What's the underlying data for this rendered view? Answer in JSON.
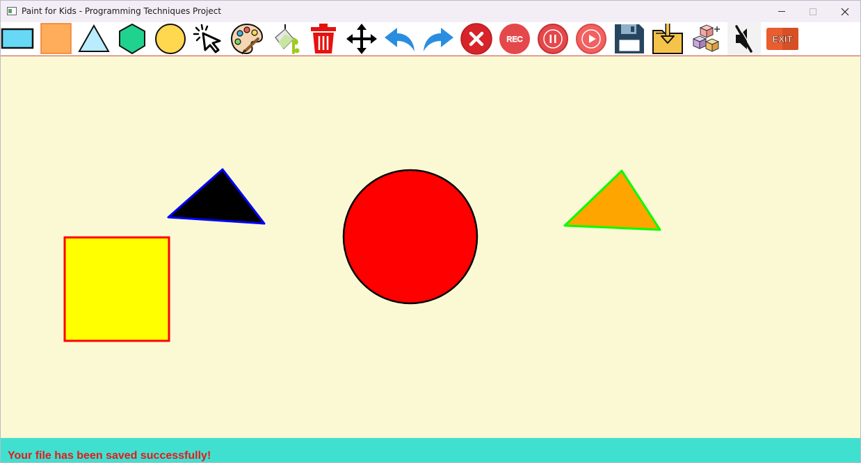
{
  "window": {
    "title": "Paint for Kids - Programming Techniques Project",
    "controls": {
      "minimize": "minimize",
      "maximize": "maximize",
      "close": "close"
    }
  },
  "toolbar": {
    "items": [
      {
        "name": "rectangle",
        "icon": "rectangle-icon",
        "color": "#68d8f7"
      },
      {
        "name": "square",
        "icon": "square-icon",
        "color": "#ffad5a"
      },
      {
        "name": "triangle",
        "icon": "triangle-icon",
        "color": "#b9ecff"
      },
      {
        "name": "hexagon",
        "icon": "hexagon-icon",
        "color": "#1fd38f"
      },
      {
        "name": "circle",
        "icon": "circle-icon",
        "color": "#ffd84f"
      },
      {
        "name": "select",
        "icon": "cursor-icon",
        "color": "#000000"
      },
      {
        "name": "draw-color",
        "icon": "palette-icon",
        "color": "#f5d6b3"
      },
      {
        "name": "fill-color",
        "icon": "paint-bucket-icon",
        "color": "#9ccc1c"
      },
      {
        "name": "delete",
        "icon": "trash-icon",
        "color": "#e5120e"
      },
      {
        "name": "move",
        "icon": "move-arrows-icon",
        "color": "#000000"
      },
      {
        "name": "undo",
        "icon": "undo-icon",
        "color": "#2a8ee0"
      },
      {
        "name": "redo",
        "icon": "redo-icon",
        "color": "#2a8ee0"
      },
      {
        "name": "clear-all",
        "icon": "close-circle-icon",
        "color": "#d7232a"
      },
      {
        "name": "record",
        "icon": "rec-icon",
        "color": "#e5484b",
        "label": "REC"
      },
      {
        "name": "pause",
        "icon": "pause-icon",
        "color": "#e5484b"
      },
      {
        "name": "play",
        "icon": "play-icon",
        "color": "#f36060"
      },
      {
        "name": "save",
        "icon": "floppy-icon",
        "color": "#27465e"
      },
      {
        "name": "load",
        "icon": "folder-download-icon",
        "color": "#f6c34a"
      },
      {
        "name": "play-mode",
        "icon": "cubes-icon",
        "color": "#f3a9a0"
      },
      {
        "name": "mute",
        "icon": "speaker-mute-icon",
        "color": "#111111"
      },
      {
        "name": "exit",
        "icon": "exit-icon",
        "color": "#e95d2f",
        "label": "EXIT"
      }
    ]
  },
  "canvas": {
    "background": "#faf9d3",
    "shapes": [
      {
        "type": "triangle",
        "fill": "#000000",
        "border": "#0000ff"
      },
      {
        "type": "circle",
        "fill": "#ff0000",
        "border": "#000000"
      },
      {
        "type": "triangle",
        "fill": "#ffa500",
        "border": "#00ff00"
      },
      {
        "type": "square",
        "fill": "#ffff00",
        "border": "#ff0000"
      }
    ]
  },
  "status": {
    "message": "Your file has been saved successfully!",
    "text_color": "#e21b1b",
    "background": "#40e0d0"
  }
}
